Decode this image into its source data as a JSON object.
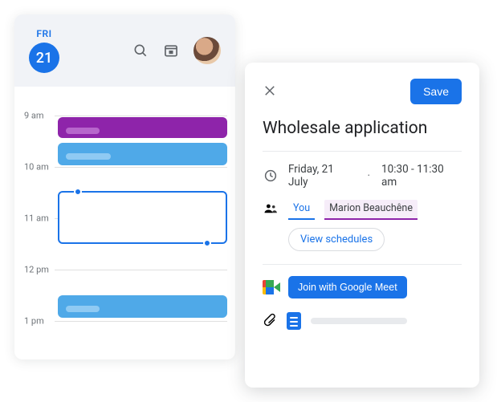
{
  "calendar": {
    "day_label": "FRI",
    "day_number": "21",
    "hours": [
      "9 am",
      "10 am",
      "11 am",
      "12 pm",
      "1 pm"
    ]
  },
  "detail": {
    "save_label": "Save",
    "title": "Wholesale application",
    "date_text": "Friday, 21 July",
    "time_text": "10:30 - 11:30 am",
    "guest_you": "You",
    "guest_other": "Marion Beauchêne",
    "view_schedules": "View schedules",
    "meet_label": "Join with Google Meet"
  }
}
